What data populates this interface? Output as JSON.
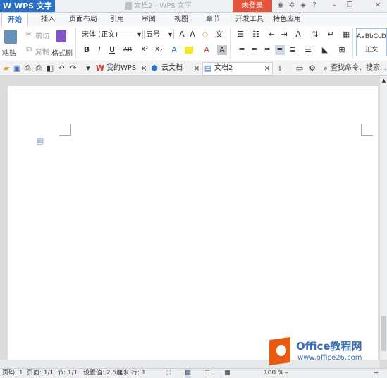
{
  "titlebar": {
    "app_name": "WPS 文字",
    "doc_title": "文档2 - WPS 文字",
    "login": "未登录"
  },
  "tabs": [
    "开始",
    "插入",
    "页面布局",
    "引用",
    "审阅",
    "视图",
    "章节",
    "开发工具",
    "特色应用"
  ],
  "ribbon": {
    "paste": "粘贴",
    "cut": "剪切",
    "copy": "复制",
    "format_painter": "格式刷",
    "font_name": "宋体 (正文)",
    "font_size": "五号",
    "style_preview": "AaBbCcD",
    "style_name": "正文"
  },
  "doc_tabs": {
    "my_wps": "我的WPS",
    "cloud_doc": "云文档",
    "current_doc": "文档2",
    "search": "查找命令、搜索..."
  },
  "status": {
    "page_num": "页码: 1",
    "pages": "页面: 1/1",
    "section": "节: 1/1",
    "setting": "设置值: 2.5厘米",
    "row": "行: 1",
    "zoom": "100 %"
  },
  "watermark": {
    "title": "Office教程网",
    "url": "www.office26.com"
  },
  "colors": {
    "accent": "#2b70c8",
    "login": "#e4553d",
    "logo_orange": "#ea5b12"
  }
}
